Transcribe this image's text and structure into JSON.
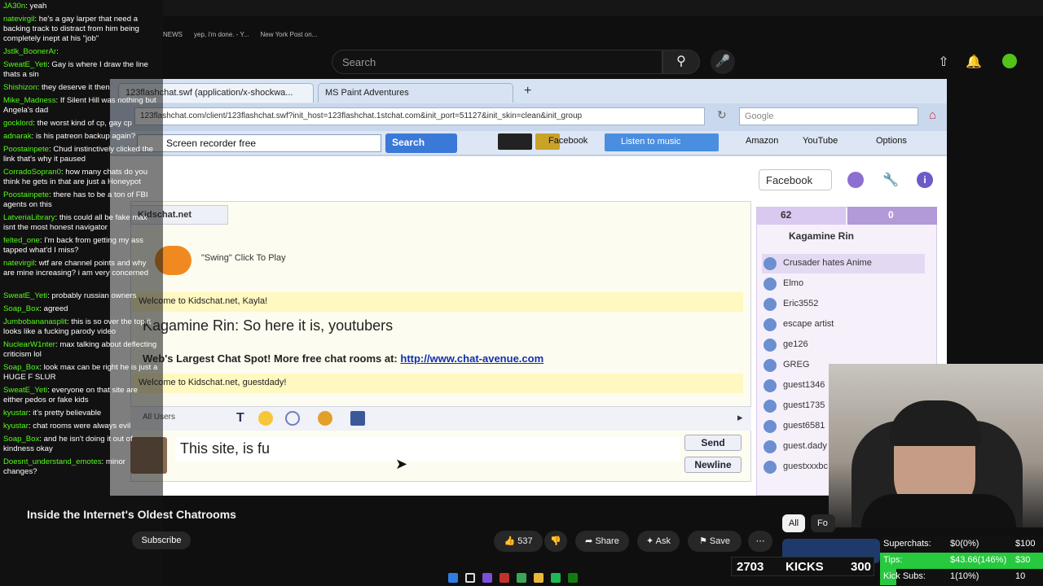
{
  "youtube": {
    "search_placeholder": "Search",
    "bookmarks": [
      "NEWS",
      "yep, i'm done. - Y...",
      "New York Post on..."
    ]
  },
  "video": {
    "browser_tabs": [
      "123flashchat.swf (application/x-shockwa...",
      "MS Paint Adventures"
    ],
    "address": "123flashchat.com/client/123flashchat.swf?init_host=123flashchat.1stchat.com&init_port=51127&init_skin=clean&init_group",
    "google_placeholder": "Google",
    "ask_input": "Screen recorder free",
    "ask_button": "Search",
    "toolbar_items": [
      "Facebook",
      "Listen to music",
      "Amazon",
      "YouTube",
      "Options"
    ],
    "facebook_button": "Facebook",
    "room_tab": "Kidschat.net",
    "swing_label": "\"Swing\"  Click To Play",
    "messages": [
      "Welcome to Kidschat.net, Kayla!",
      "Kagamine Rin: So here it is, youtubers",
      "Web's Largest Chat Spot! More free chat rooms at:",
      "http://www.chat-avenue.com",
      "Welcome to Kidschat.net, guestdady!"
    ],
    "all_users": "All Users",
    "compose_text": "This site, is fu",
    "send": "Send",
    "newline": "Newline",
    "user_count": "62",
    "friend_count": "0",
    "me": "Kagamine Rin",
    "users": [
      "Crusader hates Anime",
      "Elmo",
      "Eric3552",
      "escape artist",
      "ge126",
      "GREG",
      "guest1346",
      "guest1735",
      "guest6581",
      "guest.dady",
      "guestxxxbc"
    ]
  },
  "chat": [
    {
      "user": "JA30n",
      "text": "yeah"
    },
    {
      "user": "natevirgil",
      "text": "he's a gay larper that need a backing track to distract from him being completely inept at his \"job\""
    },
    {
      "user": "Jstlk_BoonerAr",
      "text": ""
    },
    {
      "user": "SweatE_Yeti",
      "text": "Gay is where I draw the line thats a sin"
    },
    {
      "user": "Shishizon",
      "text": "they deserve it then"
    },
    {
      "user": "Mike_Madness",
      "text": "If Silent Hill was nothing but Angela's dad"
    },
    {
      "user": "gocklord",
      "text": "the worst kind of cp, gay cp"
    },
    {
      "user": "adnarak",
      "text": "is his patreon backup again?"
    },
    {
      "user": "Poostainpete",
      "text": "Chud instinctively clicked the link that's why it paused"
    },
    {
      "user": "CorradoSopran0",
      "text": "how many chats do you think he gets in that are just a Honeypot"
    },
    {
      "user": "Poostainpete",
      "text": "there has to be a ton of FBI agents on this"
    },
    {
      "user": "LatveriaLibrary",
      "text": "this could all be fake max isnt the most honest navigator"
    },
    {
      "user": "felted_one",
      "text": "I'm back from getting my ass tapped what'd I miss?"
    },
    {
      "user": "natevirgil",
      "text": "wtf are channel points and why are mine increasing? i am very concerned"
    },
    {
      "user": "SweatE_Yeti",
      "text": "probably russian owners"
    },
    {
      "user": "Soap_Box",
      "text": "agreed"
    },
    {
      "user": "Jumbobananasplit",
      "text": "this is so over the top it looks like a fucking parody video"
    },
    {
      "user": "NuclearW1nter",
      "text": "max talking about deflecting criticism lol"
    },
    {
      "user": "Soap_Box",
      "text": "look max can be right he is just a HUGE F SLUR"
    },
    {
      "user": "SweatE_Yeti",
      "text": "everyone on that site are either pedos or fake kids"
    },
    {
      "user": "kyustar",
      "text": "it's pretty believable"
    },
    {
      "user": "kyustar",
      "text": "chat rooms were always evil"
    },
    {
      "user": "Soap_Box",
      "text": "and he isn't doing it out of kindness okay"
    },
    {
      "user": "Doesnt_understand_emotes",
      "text": "minor changes?"
    }
  ],
  "below": {
    "title": "Inside the Internet's Oldest Chatrooms",
    "subscribe": "Subscribe",
    "likes": "537",
    "share": "Share",
    "ask": "Ask",
    "save": "Save",
    "chip_all": "All",
    "chip_fo": "Fo"
  },
  "kicks": {
    "count": "2703",
    "label": "KICKS",
    "goal": "300"
  },
  "goals": [
    {
      "label": "Superchats:",
      "value": "$0(0%)",
      "target": "$100",
      "color": "#111111",
      "fraction": 0
    },
    {
      "label": "Tips:",
      "value": "$43.66(146%)",
      "target": "$30",
      "color": "#27c93f",
      "fraction": 1
    },
    {
      "label": "Kick Subs:",
      "value": "1(10%)",
      "target": "10",
      "color": "#111111",
      "fraction": 0.1
    }
  ]
}
